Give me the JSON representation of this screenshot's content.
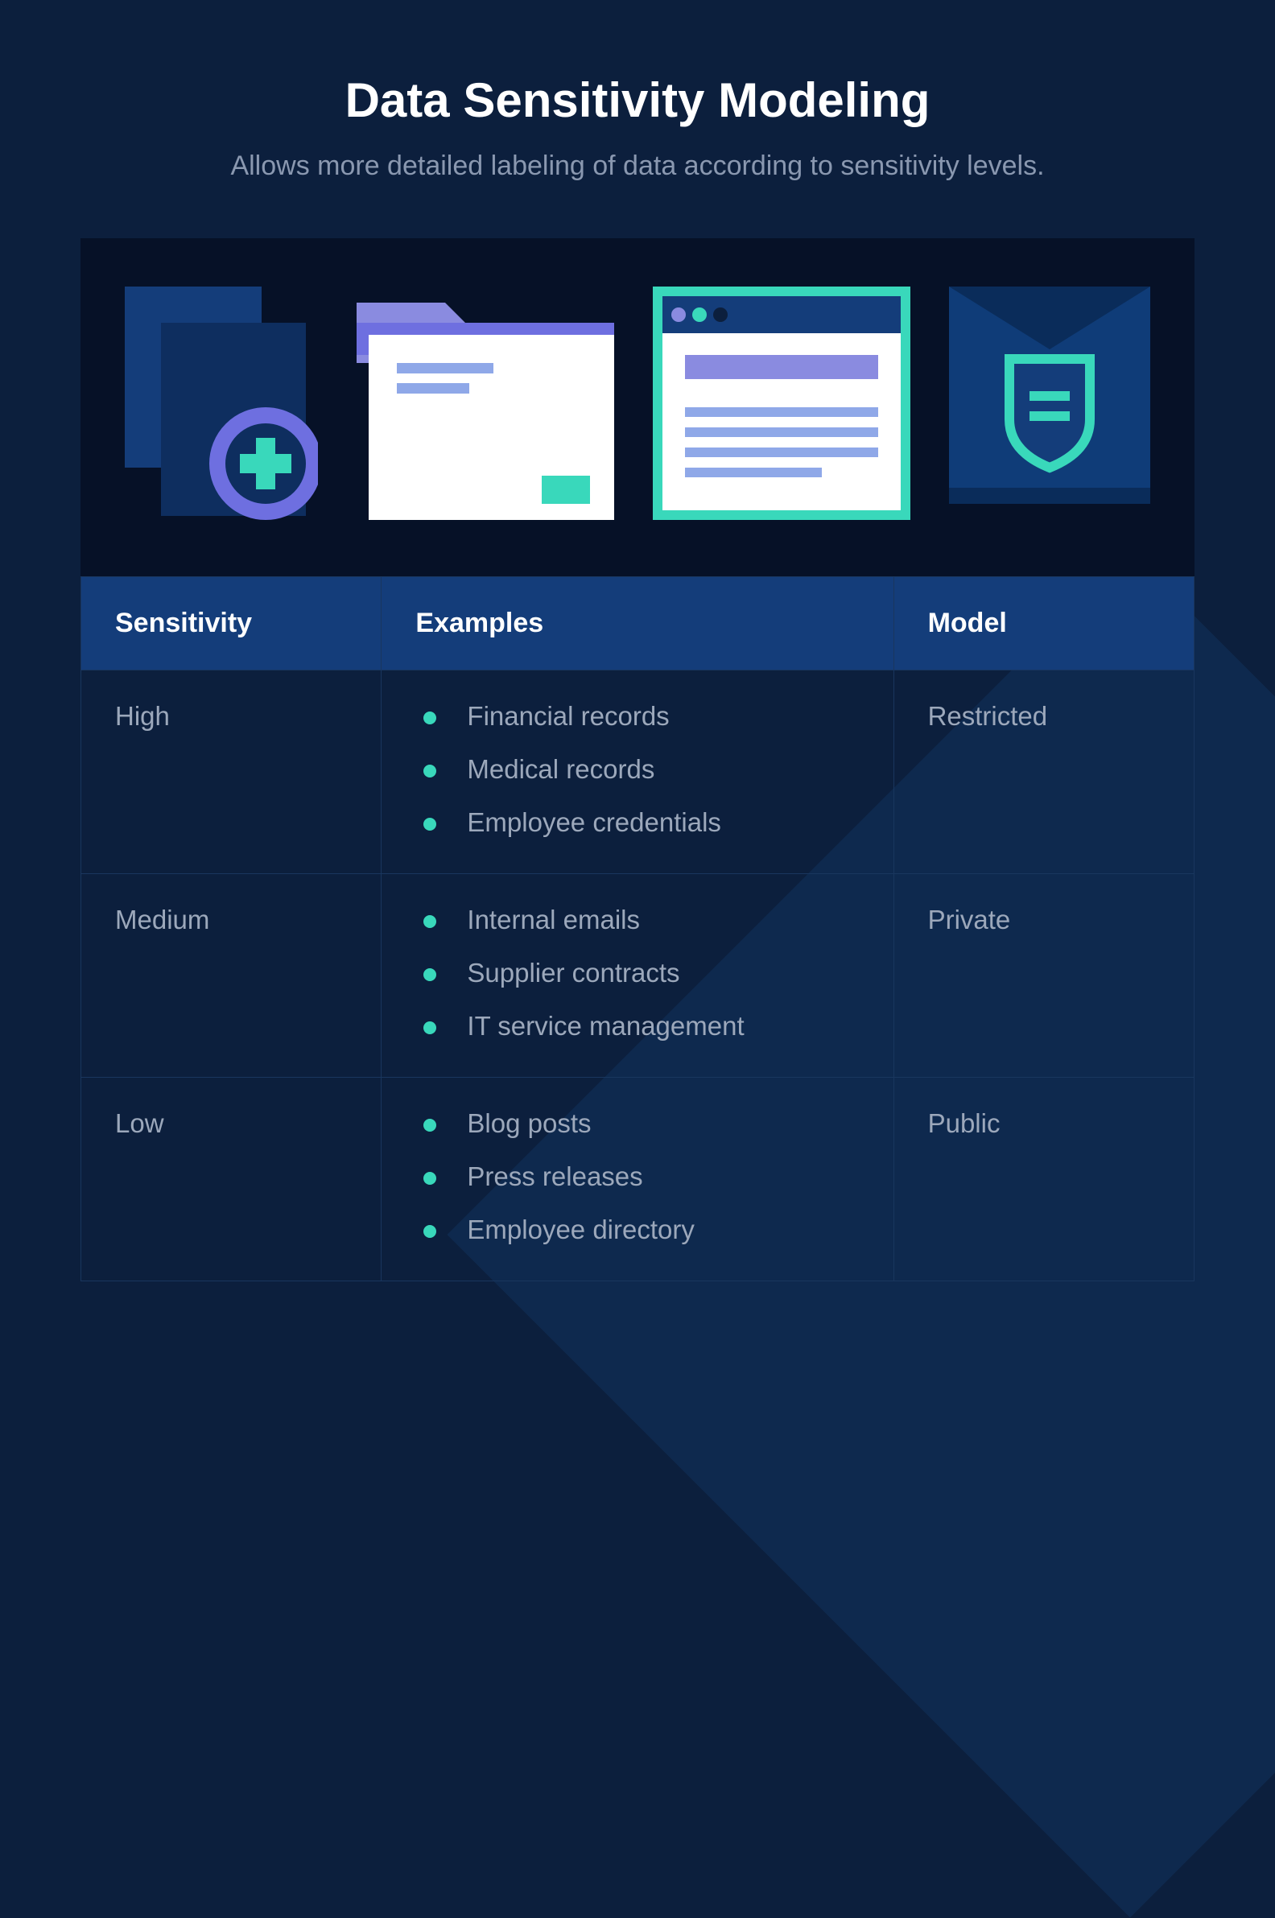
{
  "title": "Data Sensitivity Modeling",
  "subtitle": "Allows more detailed labeling of data according to sensitivity levels.",
  "columns": {
    "sensitivity": "Sensitivity",
    "examples": "Examples",
    "model": "Model"
  },
  "rows": [
    {
      "sensitivity": "High",
      "examples": [
        "Financial records",
        "Medical records",
        "Employee credentials"
      ],
      "model": "Restricted"
    },
    {
      "sensitivity": "Medium",
      "examples": [
        "Internal emails",
        "Supplier contracts",
        "IT service management"
      ],
      "model": "Private"
    },
    {
      "sensitivity": "Low",
      "examples": [
        "Blog posts",
        "Press releases",
        "Employee directory"
      ],
      "model": "Public"
    }
  ],
  "icons": {
    "doc_plus": "doc-plus-icon",
    "folder": "folder-icon",
    "browser": "browser-icon",
    "shield_env": "shield-envelope-icon"
  },
  "colors": {
    "accent_teal": "#39d8bb",
    "accent_purple": "#8a8be0",
    "header_blue": "#143d7a",
    "dark_panel": "#061127"
  }
}
